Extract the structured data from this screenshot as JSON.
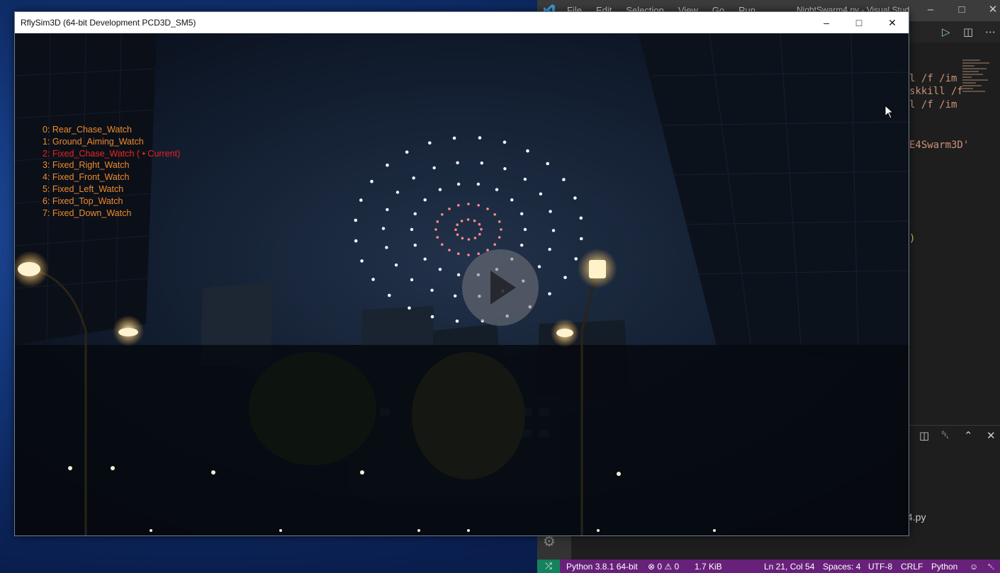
{
  "vscode": {
    "menu": [
      "File",
      "Edit",
      "Selection",
      "View",
      "Go",
      "Run",
      "…"
    ],
    "title": "NightSwarm4.py - Visual Stud",
    "code_lines": [
      "l /f /im",
      "skkill /f",
      "l /f /im",
      "E4Swarm3D'",
      ")"
    ],
    "terminal_text": "4.py",
    "status": {
      "python": "Python 3.8.1 64-bit",
      "problems": "⊗ 0 ⚠ 0",
      "size": "1.7 KiB",
      "position": "Ln 21, Col 54",
      "spaces": "Spaces: 4",
      "encoding": "UTF-8",
      "eol": "CRLF",
      "language": "Python"
    }
  },
  "rflysim": {
    "title": "RflySim3D (64-bit Development PCD3D_SM5)",
    "camera_modes": [
      {
        "label": "0: Rear_Chase_Watch",
        "current": false
      },
      {
        "label": "1: Ground_Aiming_Watch",
        "current": false
      },
      {
        "label": "2: Fixed_Chase_Watch ( • Current)",
        "current": true
      },
      {
        "label": "3: Fixed_Right_Watch",
        "current": false
      },
      {
        "label": "4: Fixed_Front_Watch",
        "current": false
      },
      {
        "label": "5: Fixed_Left_Watch",
        "current": false
      },
      {
        "label": "6: Fixed_Top_Watch",
        "current": false
      },
      {
        "label": "7: Fixed_Down_Watch",
        "current": false
      }
    ],
    "colors": {
      "camera_text": "#f08b2a",
      "current_text": "#e8261a"
    }
  },
  "icons": {
    "minimize": "–",
    "maximize": "□",
    "close": "✕",
    "run": "▷",
    "split": "◫",
    "more": "⋯",
    "trash": "␡",
    "chevron_up": "⌃",
    "gear": "⚙",
    "remote": "⤮",
    "person": "☺",
    "bell": "␇"
  }
}
